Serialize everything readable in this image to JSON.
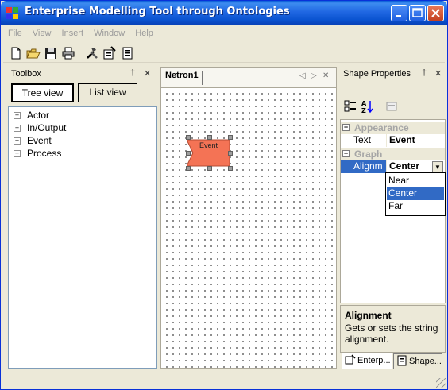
{
  "window": {
    "title": "Enterprise Modelling Tool through Ontologies",
    "controls": [
      "minimize",
      "maximize",
      "close"
    ]
  },
  "menu": {
    "items": [
      "File",
      "View",
      "Insert",
      "Window",
      "Help"
    ]
  },
  "toolbar": {
    "icons": [
      "new-file-icon",
      "open-folder-icon",
      "save-icon",
      "print-icon",
      "tools-icon",
      "properties-icon",
      "document-icon"
    ]
  },
  "toolbox": {
    "title": "Toolbox",
    "pin_glyph": "†",
    "close_glyph": "✕",
    "tabs": [
      "Tree view",
      "List view"
    ],
    "active_tab": "Tree view",
    "items": [
      "Actor",
      "In/Output",
      "Event",
      "Process"
    ],
    "expander_glyph": "+"
  },
  "document": {
    "tab_label": "Netron1",
    "nav": {
      "prev": "◁",
      "next": "▷",
      "close": "✕"
    },
    "shape": {
      "label": "Event",
      "fill": "#f47355",
      "border": "#b34b33"
    }
  },
  "properties": {
    "title": "Shape Properties",
    "pin_glyph": "†",
    "close_glyph": "✕",
    "categories": [
      {
        "name": "Appearance",
        "rows": [
          {
            "name": "Text",
            "value": "Event"
          }
        ]
      },
      {
        "name": "Graph",
        "rows": [
          {
            "name": "Alignm",
            "value": "Center",
            "selected": true
          }
        ]
      }
    ],
    "collapse_glyph": "−",
    "dropdown_arrow": "▼",
    "dropdown_options": [
      "Near",
      "Center",
      "Far"
    ],
    "dropdown_selected": "Center",
    "help": {
      "title": "Alignment",
      "description": "Gets or sets the string alignment."
    },
    "bottom_tabs": [
      "Enterp...",
      "Shape..."
    ],
    "active_bottom_tab": "Enterp..."
  },
  "colors": {
    "title_bar": "#2168e3",
    "selection": "#316ac5",
    "window_bg": "#ece9d8",
    "shape_fill": "#f47355"
  }
}
